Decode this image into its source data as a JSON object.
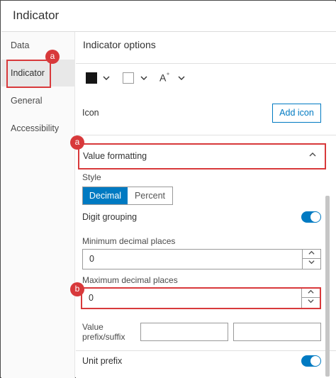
{
  "header": {
    "title": "Indicator"
  },
  "sidebar": {
    "items": [
      {
        "label": "Data"
      },
      {
        "label": "Indicator"
      },
      {
        "label": "General"
      },
      {
        "label": "Accessibility"
      }
    ]
  },
  "main": {
    "section_title": "Indicator options",
    "text_color": "#151515",
    "background_color": "#ffffff",
    "font_size_glyph": "A",
    "font_size_sup": "⁺",
    "icon_label": "Icon",
    "add_icon_label": "Add icon",
    "value_formatting": {
      "label": "Value formatting",
      "style_label": "Style",
      "style_options": [
        "Decimal",
        "Percent"
      ],
      "style_selected": "Decimal",
      "digit_grouping_label": "Digit grouping",
      "digit_grouping_on": true,
      "min_decimal_label": "Minimum decimal places",
      "min_decimal_value": "0",
      "max_decimal_label": "Maximum decimal places",
      "max_decimal_value": "0",
      "prefix_suffix_label": "Value prefix/suffix",
      "unit_prefix_label": "Unit prefix",
      "unit_prefix_on": true
    }
  },
  "annotations": {
    "a": "a",
    "b": "b"
  },
  "colors": {
    "accent": "#007ac2",
    "highlight": "#d8393b"
  }
}
